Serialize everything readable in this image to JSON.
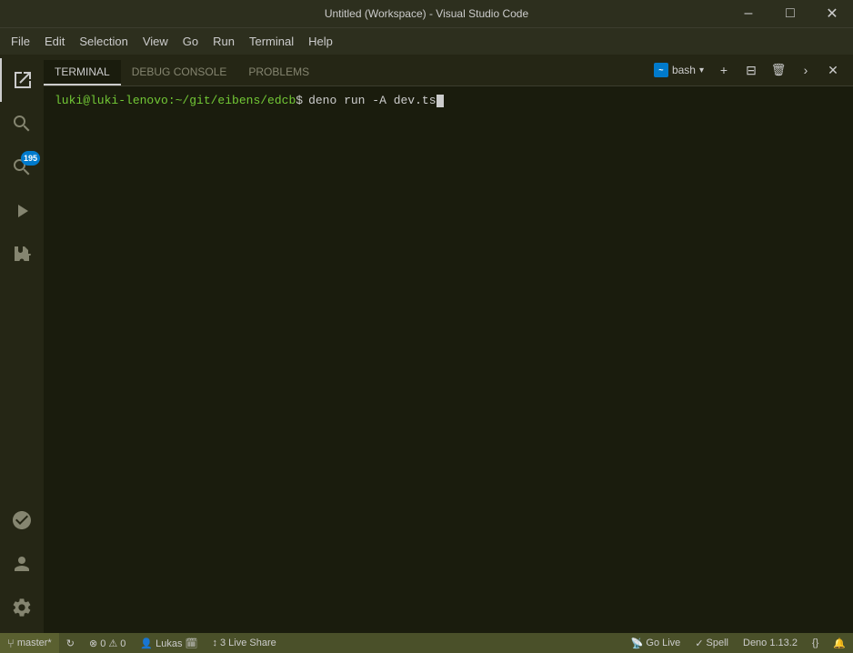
{
  "titlebar": {
    "title": "Untitled (Workspace) - Visual Studio Code",
    "controls": {
      "minimize": "–",
      "maximize": "□",
      "close": "✕"
    }
  },
  "menubar": {
    "items": [
      "File",
      "Edit",
      "Selection",
      "View",
      "Go",
      "Run",
      "Terminal",
      "Help"
    ]
  },
  "activitybar": {
    "icons": [
      {
        "name": "explorer-icon",
        "symbol": "⎗",
        "active": true
      },
      {
        "name": "search-icon",
        "symbol": "🔍"
      },
      {
        "name": "source-control-icon",
        "symbol": "⑂",
        "badge": "195"
      },
      {
        "name": "run-debug-icon",
        "symbol": "▷"
      },
      {
        "name": "extensions-icon",
        "symbol": "⊞"
      }
    ],
    "bottom": [
      {
        "name": "remote-icon",
        "symbol": "◎"
      },
      {
        "name": "account-icon",
        "symbol": "◉"
      },
      {
        "name": "settings-icon",
        "symbol": "⚙"
      }
    ]
  },
  "panel": {
    "tabs": [
      {
        "label": "TERMINAL",
        "active": true
      },
      {
        "label": "DEBUG CONSOLE",
        "active": false
      },
      {
        "label": "PROBLEMS",
        "active": false
      }
    ],
    "toolbar": {
      "shell_label": "bash",
      "add_label": "+",
      "split_label": "⊟",
      "trash_label": "🗑",
      "more_label": "›",
      "close_label": "✕"
    }
  },
  "terminal": {
    "prompt_user": "luki@luki-lenovo",
    "prompt_path": ":~/git/eibens/edcb",
    "prompt_dollar": "$",
    "command": "deno run -A dev.ts"
  },
  "statusbar": {
    "left": [
      {
        "name": "git-branch",
        "icon": "⑂",
        "label": "master*"
      },
      {
        "name": "sync-icon",
        "icon": "↻",
        "label": ""
      },
      {
        "name": "errors-warnings",
        "icon": "",
        "label": "⊗ 0  ⚠ 0"
      },
      {
        "name": "live-share-status",
        "icon": "↑",
        "label": "Lukas 🗓"
      },
      {
        "name": "live-share-btn",
        "icon": "↕",
        "label": "Live Share"
      }
    ],
    "right": [
      {
        "name": "go-live",
        "label": "Go Live",
        "icon": "📡"
      },
      {
        "name": "spell-check",
        "label": "Spell"
      },
      {
        "name": "deno-version",
        "label": "Deno 1.13.2"
      },
      {
        "name": "prettier-icon",
        "icon": "{}"
      },
      {
        "name": "notification-icon",
        "icon": "🔔"
      }
    ]
  }
}
